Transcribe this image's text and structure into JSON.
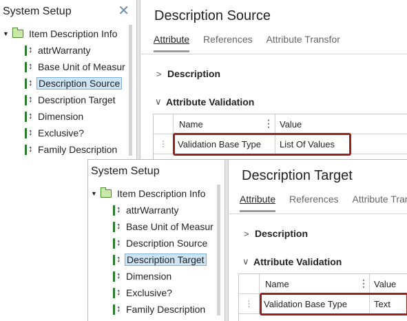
{
  "screens": [
    {
      "system_setup": {
        "title": "System Setup",
        "close_icon": "close-icon",
        "tree": {
          "root": "Item Description Info",
          "items": [
            {
              "label": "attrWarranty",
              "selected": false
            },
            {
              "label": "Base Unit of Measur",
              "selected": false
            },
            {
              "label": "Description Source",
              "selected": true
            },
            {
              "label": "Description Target",
              "selected": false
            },
            {
              "label": "Dimension",
              "selected": false
            },
            {
              "label": "Exclusive?",
              "selected": false
            },
            {
              "label": "Family Description",
              "selected": false
            }
          ]
        }
      },
      "detail": {
        "title": "Description Source",
        "tabs": [
          "Attribute",
          "References",
          "Attribute Transfor"
        ],
        "active_tab": "Attribute",
        "sections": [
          {
            "label": "Description",
            "expanded": false
          },
          {
            "label": "Attribute Validation",
            "expanded": true
          }
        ],
        "grid": {
          "columns": [
            "Name",
            "Value"
          ],
          "rows": [
            {
              "name": "Validation Base Type",
              "value": "List Of Values"
            }
          ]
        }
      }
    },
    {
      "system_setup": {
        "title": "System Setup",
        "tree": {
          "root": "Item Description Info",
          "items": [
            {
              "label": "attrWarranty",
              "selected": false
            },
            {
              "label": "Base Unit of Measur",
              "selected": false
            },
            {
              "label": "Description Source",
              "selected": false
            },
            {
              "label": "Description Target",
              "selected": true
            },
            {
              "label": "Dimension",
              "selected": false
            },
            {
              "label": "Exclusive?",
              "selected": false
            },
            {
              "label": "Family Description",
              "selected": false
            }
          ]
        }
      },
      "detail": {
        "title": "Description Target",
        "tabs": [
          "Attribute",
          "References",
          "Attribute Tran"
        ],
        "active_tab": "Attribute",
        "sections": [
          {
            "label": "Description",
            "expanded": false
          },
          {
            "label": "Attribute Validation",
            "expanded": true
          }
        ],
        "grid": {
          "columns": [
            "Name",
            "Value"
          ],
          "rows": [
            {
              "name": "Validation Base Type",
              "value": "Text"
            }
          ]
        }
      }
    }
  ],
  "colors": {
    "highlight": "#9b2020",
    "selection": "#cde4f5",
    "folder": "#c9e9a8"
  }
}
